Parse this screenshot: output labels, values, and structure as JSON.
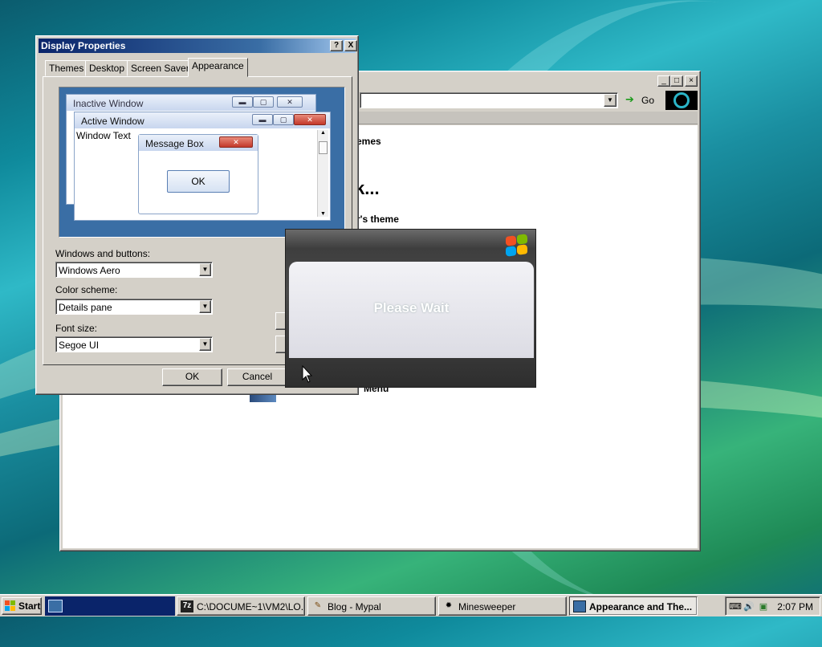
{
  "colors": {
    "dialog_title_start": "#0a246a",
    "dialog_title_end": "#a6caf0",
    "preview_bg": "#3a6ea5",
    "splash_dark": "#3e3e3e"
  },
  "browser": {
    "address_go": "Go",
    "content_lines": [
      "emes",
      "k...",
      "r's theme",
      "Menu"
    ]
  },
  "dialog": {
    "title": "Display Properties",
    "help_btn": "?",
    "close_btn": "X",
    "tabs": [
      "Themes",
      "Desktop",
      "Screen Saver",
      "Appearance"
    ],
    "active_tab": "Appearance",
    "preview": {
      "inactive_title": "Inactive Window",
      "active_title": "Active Window",
      "window_text": "Window Text",
      "message_box_title": "Message Box",
      "ok": "OK"
    },
    "fields": {
      "windows_buttons_label": "Windows and buttons:",
      "windows_buttons_value": "Windows Aero",
      "color_scheme_label": "Color scheme:",
      "color_scheme_value": "Details pane",
      "font_size_label": "Font size:",
      "font_size_value": "Segoe UI"
    },
    "ok": "OK",
    "cancel": "Cancel"
  },
  "splash": {
    "text": "Please Wait"
  },
  "taskbar": {
    "start": "Start",
    "tasks": [
      {
        "icon": "7z-icon",
        "label": "C:\\DOCUME~1\\VM2\\LO..."
      },
      {
        "icon": "blog-icon",
        "label": "Blog - Mypal"
      },
      {
        "icon": "minesweeper-icon",
        "label": "Minesweeper"
      },
      {
        "icon": "display-icon",
        "label": "Appearance and The..."
      }
    ],
    "clock": "2:07 PM"
  }
}
